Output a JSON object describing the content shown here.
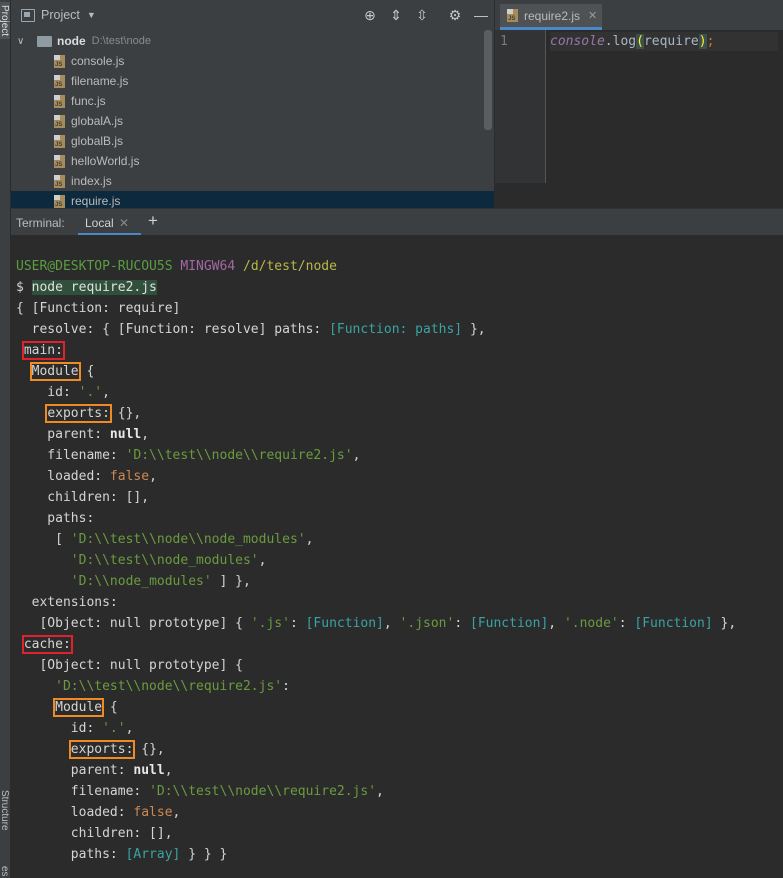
{
  "sidebar": {
    "project_tab": "Project",
    "structure_tab": "Structure",
    "favorites_tab": "es"
  },
  "project": {
    "title": "Project",
    "root_name": "node",
    "root_path": "D:\\test\\node",
    "files": [
      "console.js",
      "filename.js",
      "func.js",
      "globalA.js",
      "globalB.js",
      "helloWorld.js",
      "index.js",
      "require.js"
    ],
    "selected_file": "require.js"
  },
  "editor": {
    "tab_label": "require2.js",
    "line_number": "1",
    "code": {
      "obj": "console",
      "dot": ".",
      "method": "log",
      "open": "(",
      "arg": "require",
      "close": ")",
      "semi": ";"
    }
  },
  "terminal": {
    "label": "Terminal:",
    "tab_label": "Local",
    "prompt_user": "USER@DESKTOP-RUCOU5S",
    "prompt_env": "MINGW64",
    "prompt_path": "/d/test/node",
    "prompt_symbol": "$",
    "command": "node require2.js",
    "lines": {
      "l1": "{ [Function: require]",
      "l2a": "  resolve: { [Function: resolve] paths: ",
      "l2b": "[Function: paths]",
      "l2c": " },",
      "main": "main:",
      "module1": "Module",
      "brace": " {",
      "id_key": "    id: ",
      "id_val": "'.'",
      "comma": ",",
      "exports1": "exports:",
      "exports_val": " {},",
      "parent": "    parent: ",
      "null": "null",
      "filename": "    filename: ",
      "filename_val": "'D:\\\\test\\\\node\\\\require2.js'",
      "loaded": "    loaded: ",
      "false": "false",
      "children": "    children: [],",
      "paths": "    paths:",
      "p1a": "     [ ",
      "p1b": "'D:\\\\test\\\\node\\\\node_modules'",
      "p2": "'D:\\\\test\\\\node_modules'",
      "p3": "'D:\\\\node_modules'",
      "p3end": " ] },",
      "extensions": "  extensions:",
      "ext_a": "   [Object: null prototype] { ",
      "ext_js": "'.js'",
      "colon": ": ",
      "fn": "[Function]",
      "ext_json": "'.json'",
      "ext_node": "'.node'",
      "ext_end": " },",
      "cache": "cache:",
      "cache_obj": "   [Object: null prototype] {",
      "cache_key": "'D:\\\\test\\\\node\\\\require2.js'",
      "cache_colon": ":",
      "module2": "Module",
      "brace2": " {",
      "id2_key": "       id: ",
      "exports2": "exports:",
      "parent2": "       parent: ",
      "filename2": "       filename: ",
      "loaded2": "       loaded: ",
      "children2": "       children: [],",
      "paths2": "       paths: ",
      "array": "[Array]",
      "end": " } } }"
    }
  },
  "colors": {
    "annotation_red": "#e0222d",
    "annotation_orange": "#f08a24",
    "accent": "#4a88c7"
  }
}
